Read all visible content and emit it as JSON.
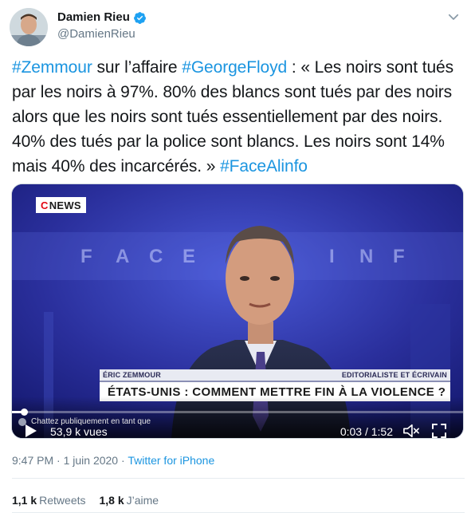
{
  "author": {
    "display_name": "Damien Rieu",
    "handle": "@DamienRieu",
    "verified": true
  },
  "tweet": {
    "segments": [
      {
        "text": "#Zemmour",
        "tag": true
      },
      {
        "text": " sur l’affaire ",
        "tag": false
      },
      {
        "text": "#GeorgeFloyd",
        "tag": true
      },
      {
        "text": " : « Les noirs sont tués par les noirs à 97%. 80% des blancs sont tués par des noirs alors que les noirs sont tués essentiellement par des noirs. 40% des tués par la police sont blancs. Les noirs sont 14% mais 40% des incarcérés. » ",
        "tag": false
      },
      {
        "text": "#FaceAlinfo",
        "tag": true
      }
    ]
  },
  "video": {
    "channel_logo_c": "C",
    "channel_logo_name": "NEWS",
    "lower_third_name": "ÉRIC ZEMMOUR",
    "lower_third_role": "EDITORIALISTE ET ÉCRIVAIN",
    "headline": "ÉTATS-UNIS : COMMENT METTRE FIN À LA VIOLENCE ?",
    "chat_placeholder": "Chattez publiquement en tant que",
    "views": "53,9 k vues",
    "time": "0:03 / 1:52",
    "progress": 0.027
  },
  "meta": {
    "time": "9:47 PM",
    "separator": " · ",
    "date": "1 juin 2020",
    "source": "Twitter for iPhone"
  },
  "stats": {
    "retweets_count": "1,1 k",
    "retweets_label": "Retweets",
    "likes_count": "1,8 k",
    "likes_label": "J’aime"
  },
  "colors": {
    "link": "#1b95e0",
    "text": "#14171a",
    "secondary": "#657786",
    "verified": "#1da1f2",
    "studio": "#1a2080"
  },
  "icons": [
    "verified-badge-icon",
    "chevron-down-icon",
    "play-icon",
    "volume-icon",
    "fullscreen-icon",
    "chat-avatar-icon"
  ]
}
